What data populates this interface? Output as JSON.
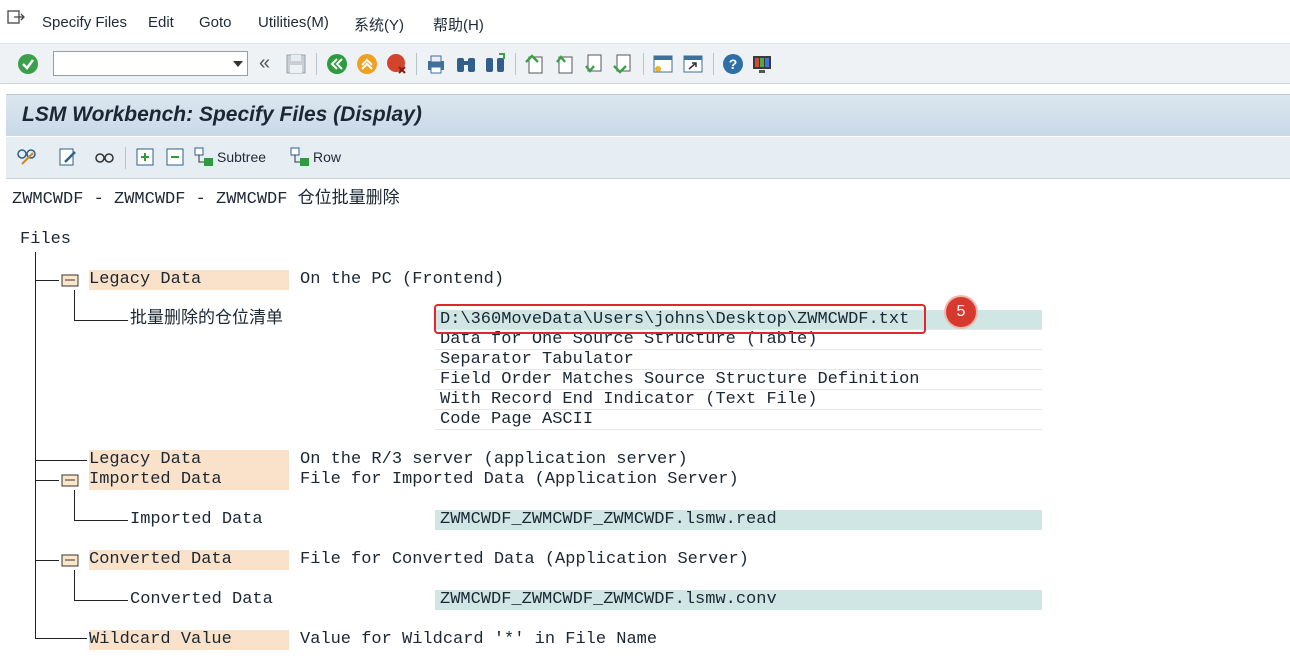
{
  "menu": {
    "items": [
      {
        "label": "Specify Files"
      },
      {
        "label": "Edit"
      },
      {
        "label": "Goto"
      },
      {
        "label": "Utilities(M)"
      },
      {
        "label": "系统(Y)"
      },
      {
        "label": "帮助(H)"
      }
    ]
  },
  "toolbar": {
    "command_value": "",
    "icons": [
      "enter-icon",
      "back-arrows-icon",
      "save-icon",
      "back-icon",
      "exit-icon",
      "cancel-icon",
      "print-icon",
      "find-icon",
      "find-next-icon",
      "first-page-icon",
      "previous-page-icon",
      "next-page-icon",
      "last-page-icon",
      "create-session-icon",
      "shortcut-icon",
      "help-icon",
      "customize-layout-icon"
    ]
  },
  "title": "LSM Workbench: Specify Files (Display)",
  "app_toolbar": {
    "subtree_label": "Subtree",
    "row_label": "Row"
  },
  "tree": {
    "header": "ZWMCWDF - ZWMCWDF - ZWMCWDF 仓位批量删除",
    "root": "Files",
    "legacy_pc": {
      "label": "Legacy Data",
      "desc": "On the PC (Frontend)"
    },
    "pc_file": {
      "name": "批量删除的仓位清单",
      "path": "D:\\360MoveData\\Users\\johns\\Desktop\\ZWMCWDF.txt",
      "details": [
        "Data for One Source Structure (Table)",
        "Separator Tabulator",
        "Field Order Matches Source Structure Definition",
        "With Record End Indicator (Text File)",
        "Code Page ASCII"
      ]
    },
    "legacy_server": {
      "label": "Legacy Data",
      "desc": "On the R/3 server (application server)"
    },
    "imported": {
      "label": "Imported Data",
      "desc": "File for Imported Data (Application Server)",
      "child": "Imported Data",
      "file": "ZWMCWDF_ZWMCWDF_ZWMCWDF.lsmw.read"
    },
    "converted": {
      "label": "Converted Data",
      "desc": "File for Converted Data (Application Server)",
      "child": "Converted Data",
      "file": "ZWMCWDF_ZWMCWDF_ZWMCWDF.lsmw.conv"
    },
    "wildcard": {
      "label": "Wildcard Value",
      "desc": "Value for Wildcard '*' in File Name"
    }
  },
  "annotation": {
    "step": "5",
    "color": "#d63a2f"
  }
}
